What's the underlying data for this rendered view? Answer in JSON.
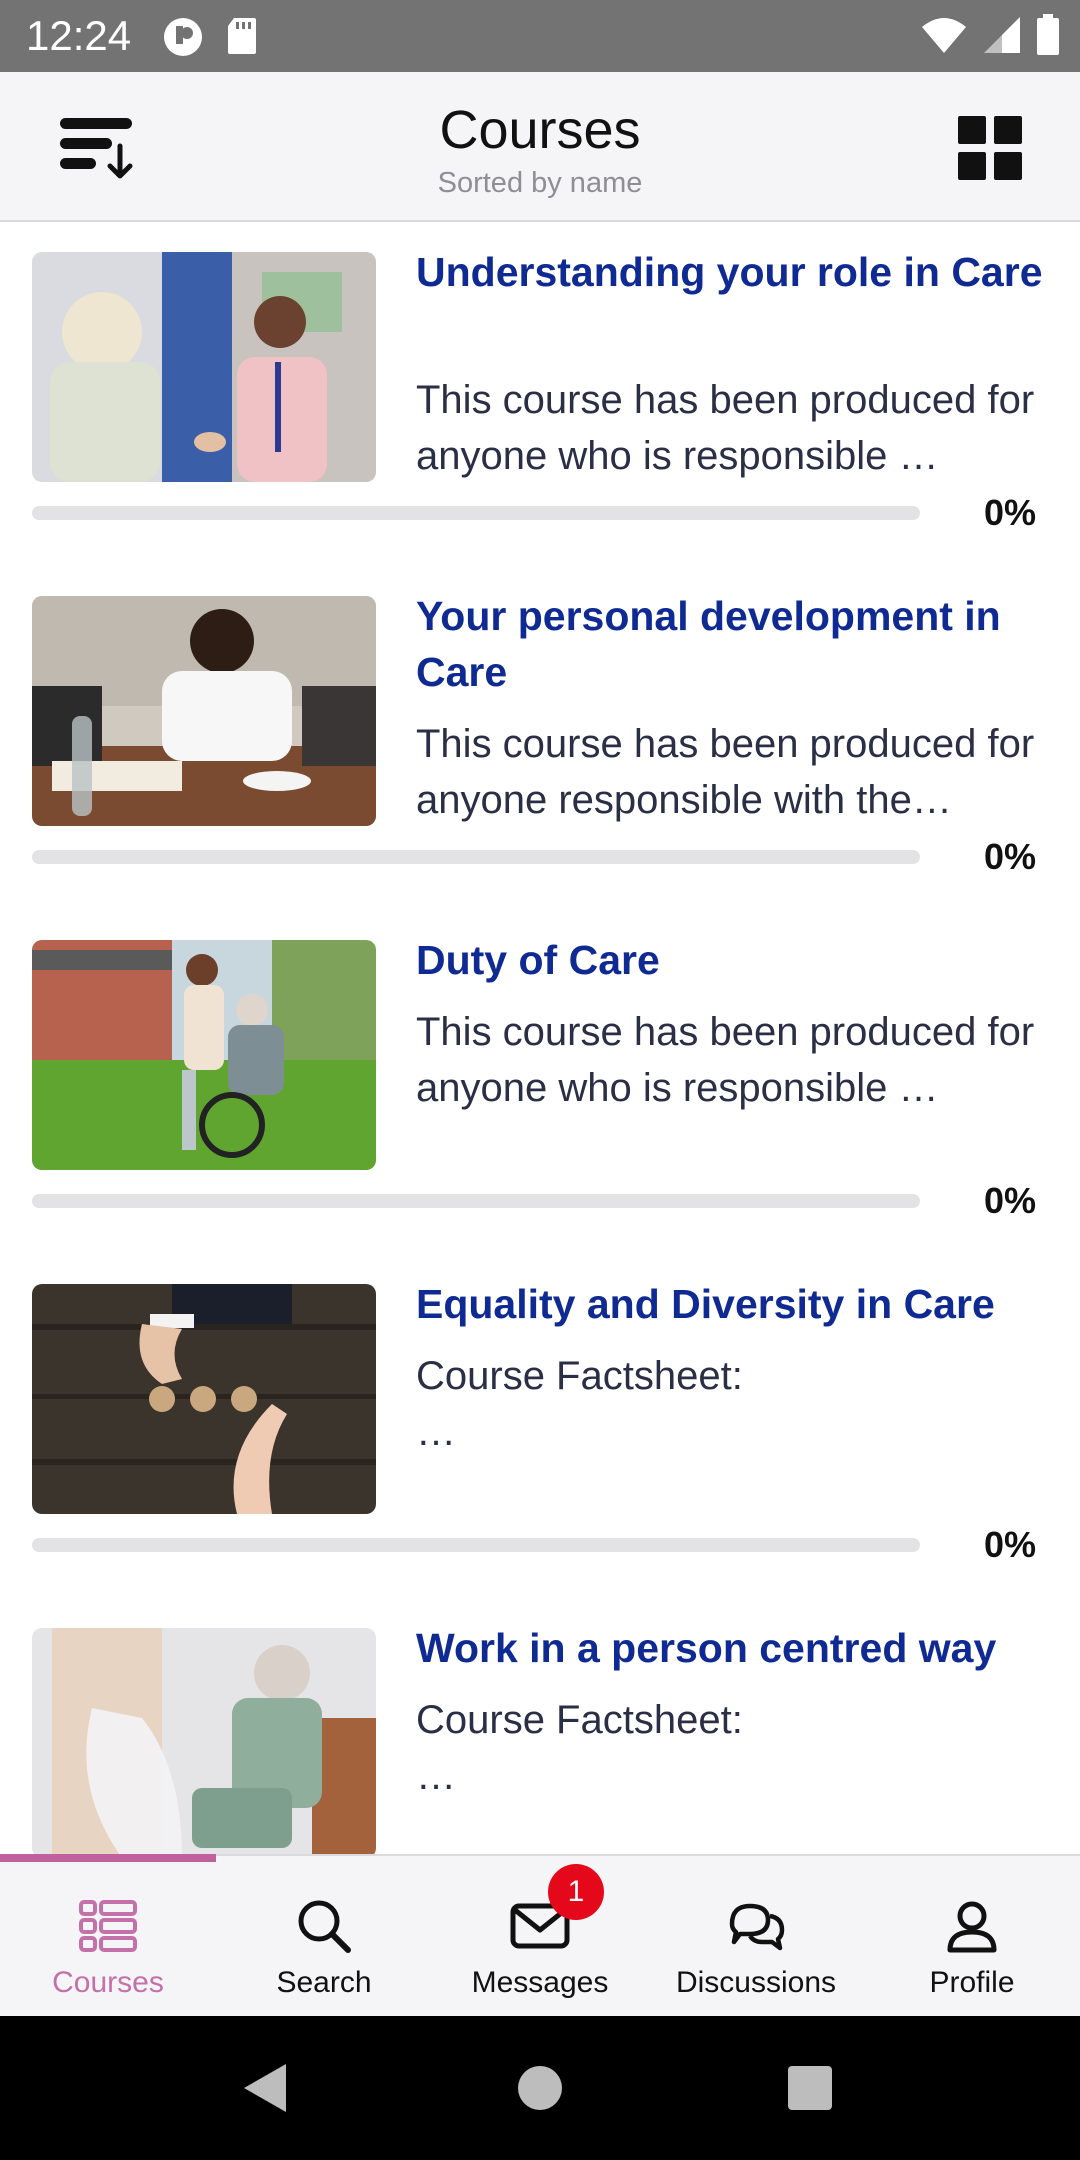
{
  "status_bar": {
    "time": "12:24"
  },
  "app_bar": {
    "title": "Courses",
    "subtitle": "Sorted by name",
    "sort_icon": "sort-descending-icon",
    "layout_icon": "grid-view-icon"
  },
  "courses": [
    {
      "title": "Understanding your role in Care",
      "description": "This course has been produced for anyone who is responsible …",
      "progress_label": "0%",
      "progress": 0
    },
    {
      "title": "Your personal development in Care",
      "description": "This course has been produced for anyone responsible with the…",
      "progress_label": "0%",
      "progress": 0
    },
    {
      "title": "Duty of Care",
      "description": "This course has been produced for anyone who is responsible …",
      "progress_label": "0%",
      "progress": 0
    },
    {
      "title": "Equality and Diversity in Care",
      "description": "Course Factsheet:",
      "description_more": "…",
      "progress_label": "0%",
      "progress": 0
    },
    {
      "title": "Work in a person centred way",
      "description": "Course Factsheet:",
      "description_more": "…"
    }
  ],
  "bottom_nav": {
    "items": [
      {
        "label": "Courses",
        "icon": "courses-icon",
        "active": true
      },
      {
        "label": "Search",
        "icon": "search-icon"
      },
      {
        "label": "Messages",
        "icon": "mail-icon",
        "badge": "1"
      },
      {
        "label": "Discussions",
        "icon": "chat-bubbles-icon"
      },
      {
        "label": "Profile",
        "icon": "profile-icon"
      }
    ]
  },
  "colors": {
    "accent": "#c470a9",
    "title_blue": "#0f2a92",
    "badge_red": "#e5081b",
    "status_bar": "#737373"
  }
}
